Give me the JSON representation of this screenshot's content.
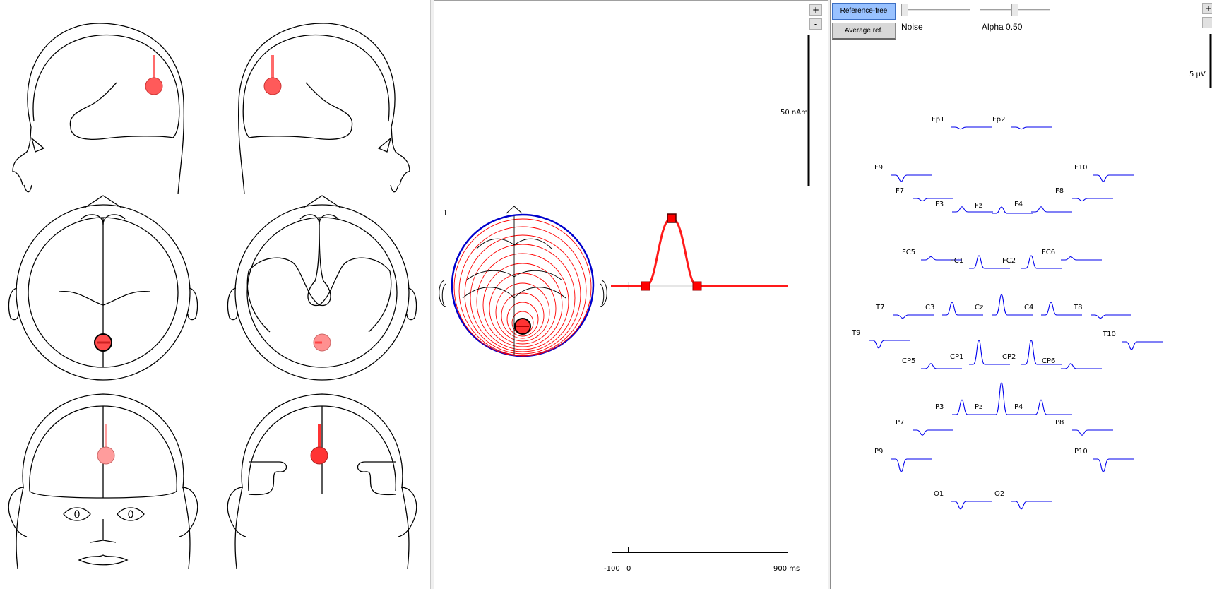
{
  "middle": {
    "source_index": "1",
    "scale_label": "50 nAm",
    "time_axis": {
      "start_label": "-100",
      "zero_label": "0",
      "end_label": "900 ms"
    },
    "zoom_in": "+",
    "zoom_out": "-"
  },
  "right": {
    "reference_free_label": "Reference-free",
    "average_ref_label": "Average ref.",
    "noise_label": "Noise",
    "alpha_label": "Alpha 0.50",
    "noise_value": 0.0,
    "alpha_value": 0.5,
    "scale_label": "5 µV",
    "zoom_in": "+",
    "zoom_out": "-",
    "channels": [
      {
        "name": "Fp1",
        "amp": -0.3
      },
      {
        "name": "Fp2",
        "amp": -0.3
      },
      {
        "name": "F9",
        "amp": -1.0
      },
      {
        "name": "F10",
        "amp": -1.0
      },
      {
        "name": "F7",
        "amp": -0.4
      },
      {
        "name": "F8",
        "amp": -0.4
      },
      {
        "name": "F3",
        "amp": 0.8
      },
      {
        "name": "Fz",
        "amp": 1.0
      },
      {
        "name": "F4",
        "amp": 0.8
      },
      {
        "name": "FC5",
        "amp": 0.5
      },
      {
        "name": "FC1",
        "amp": 2.0
      },
      {
        "name": "FC2",
        "amp": 2.0
      },
      {
        "name": "FC6",
        "amp": 0.5
      },
      {
        "name": "T7",
        "amp": -0.5
      },
      {
        "name": "C3",
        "amp": 2.0
      },
      {
        "name": "Cz",
        "amp": 3.2
      },
      {
        "name": "C4",
        "amp": 2.0
      },
      {
        "name": "T8",
        "amp": -0.5
      },
      {
        "name": "T9",
        "amp": -1.2
      },
      {
        "name": "T10",
        "amp": -1.2
      },
      {
        "name": "CP5",
        "amp": 0.8
      },
      {
        "name": "CP1",
        "amp": 3.8
      },
      {
        "name": "CP2",
        "amp": 3.8
      },
      {
        "name": "CP6",
        "amp": 0.8
      },
      {
        "name": "P3",
        "amp": 2.3
      },
      {
        "name": "Pz",
        "amp": 5.0
      },
      {
        "name": "P4",
        "amp": 2.3
      },
      {
        "name": "P7",
        "amp": -0.8
      },
      {
        "name": "P8",
        "amp": -0.8
      },
      {
        "name": "P9",
        "amp": -2.0
      },
      {
        "name": "P10",
        "amp": -2.0
      },
      {
        "name": "O1",
        "amp": -1.2
      },
      {
        "name": "O2",
        "amp": -1.2
      }
    ]
  },
  "colors": {
    "dipole": "#ff4d4d",
    "dipole_stem": "#ff6b6b",
    "waveform": "#0000ee",
    "source_curve": "#ff1a1a",
    "contour_pos": "#ff0000",
    "contour_neg": "#0000cc",
    "reference_free_active": "#99c2ff"
  }
}
